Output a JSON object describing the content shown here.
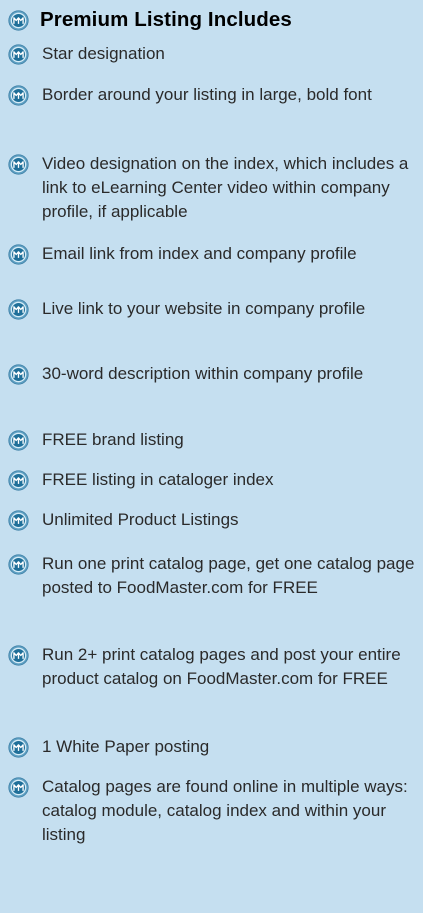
{
  "header": {
    "title": "Premium Listing Includes",
    "icon": "foodmaster-logo-icon"
  },
  "colors": {
    "background": "#c5dff0",
    "icon_outer": "#5e9fc2",
    "icon_inner": "#1f6f99",
    "text": "#2a2a2a",
    "title": "#000000"
  },
  "items": [
    "Star designation",
    "Border around your listing in large, bold font",
    "Video designation on the index, which includes a link to eLearning Center video within company profile, if applicable",
    "Email link from index and company profile",
    "Live link to your website in company profile",
    "30-word description within company profile",
    "FREE brand listing",
    "FREE listing in cataloger index",
    "Unlimited Product Listings",
    "Run one print catalog page, get one catalog page posted to FoodMaster.com for FREE",
    "Run 2+ print catalog pages and post your entire product catalog on FoodMaster.com for FREE",
    "1 White Paper posting",
    "Catalog pages are found online in multiple ways: catalog module, catalog index and within your listing"
  ]
}
